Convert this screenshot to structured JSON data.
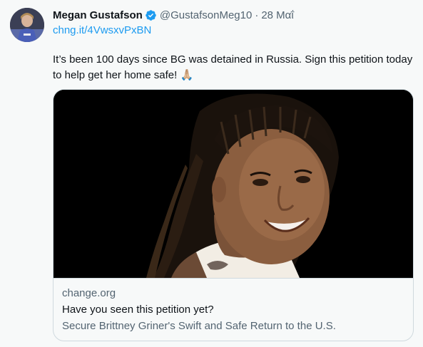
{
  "tweet": {
    "author_name": "Megan Gustafson",
    "author_handle": "@GustafsonMeg10",
    "separator": "·",
    "date": "28 Μαΐ",
    "link_text": "chng.it/4VwsxvPxBN",
    "text": "It’s been 100 days since BG was detained in Russia. Sign this petition today to help get her home safe! 🙏🏼",
    "verified_icon": "verified-badge-icon",
    "accent_color": "#1d9bf0"
  },
  "card": {
    "domain": "change.org",
    "title": "Have you seen this petition yet?",
    "description": "Secure Brittney Griner's Swift and Safe Return to the U.S."
  }
}
